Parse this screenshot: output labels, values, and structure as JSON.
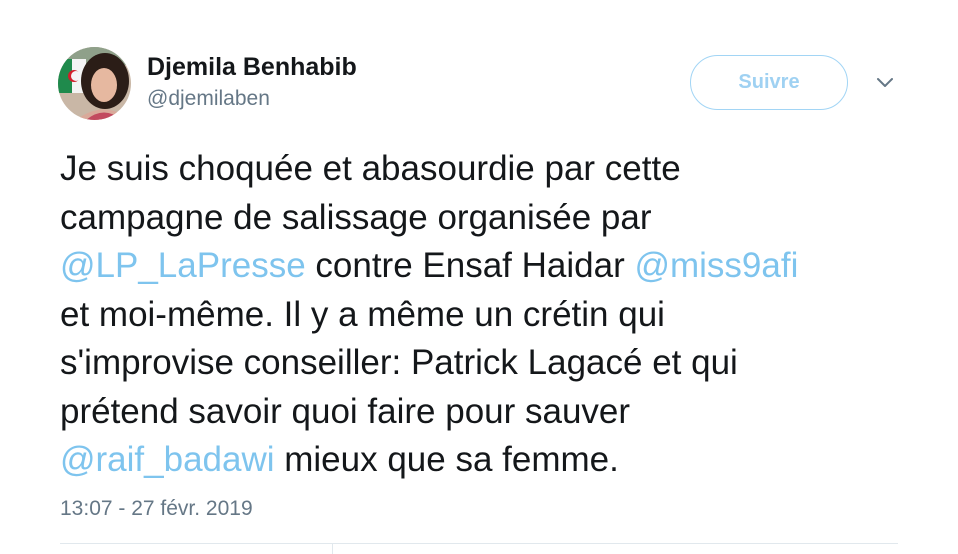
{
  "author": {
    "name": "Djemila Benhabib",
    "handle": "@djemilaben"
  },
  "follow_button": {
    "label": "Suivre"
  },
  "menu": {
    "icon": "chevron-down-icon"
  },
  "tweet": {
    "lines": [
      [
        {
          "text": "Je suis choquée et abasourdie par cette"
        }
      ],
      [
        {
          "text": "campagne de salissage organisée par"
        }
      ],
      [
        {
          "text": "@LP_LaPresse",
          "mention": true
        },
        {
          "text": " contre Ensaf Haidar "
        },
        {
          "text": "@miss9afi",
          "mention": true
        }
      ],
      [
        {
          "text": "et moi-même. Il y a même un crétin qui"
        }
      ],
      [
        {
          "text": "s'improvise conseiller: Patrick Lagacé et qui"
        }
      ],
      [
        {
          "text": "prétend savoir quoi faire pour sauver"
        }
      ],
      [
        {
          "text": "@raif_badawi",
          "mention": true
        },
        {
          "text": " mieux que sa femme."
        }
      ]
    ],
    "timestamp": "13:07 - 27 févr. 2019"
  },
  "colors": {
    "text": "#14171a",
    "secondary": "#657786",
    "mention": "#7ec4ee",
    "button_border": "#a2d5f5"
  }
}
